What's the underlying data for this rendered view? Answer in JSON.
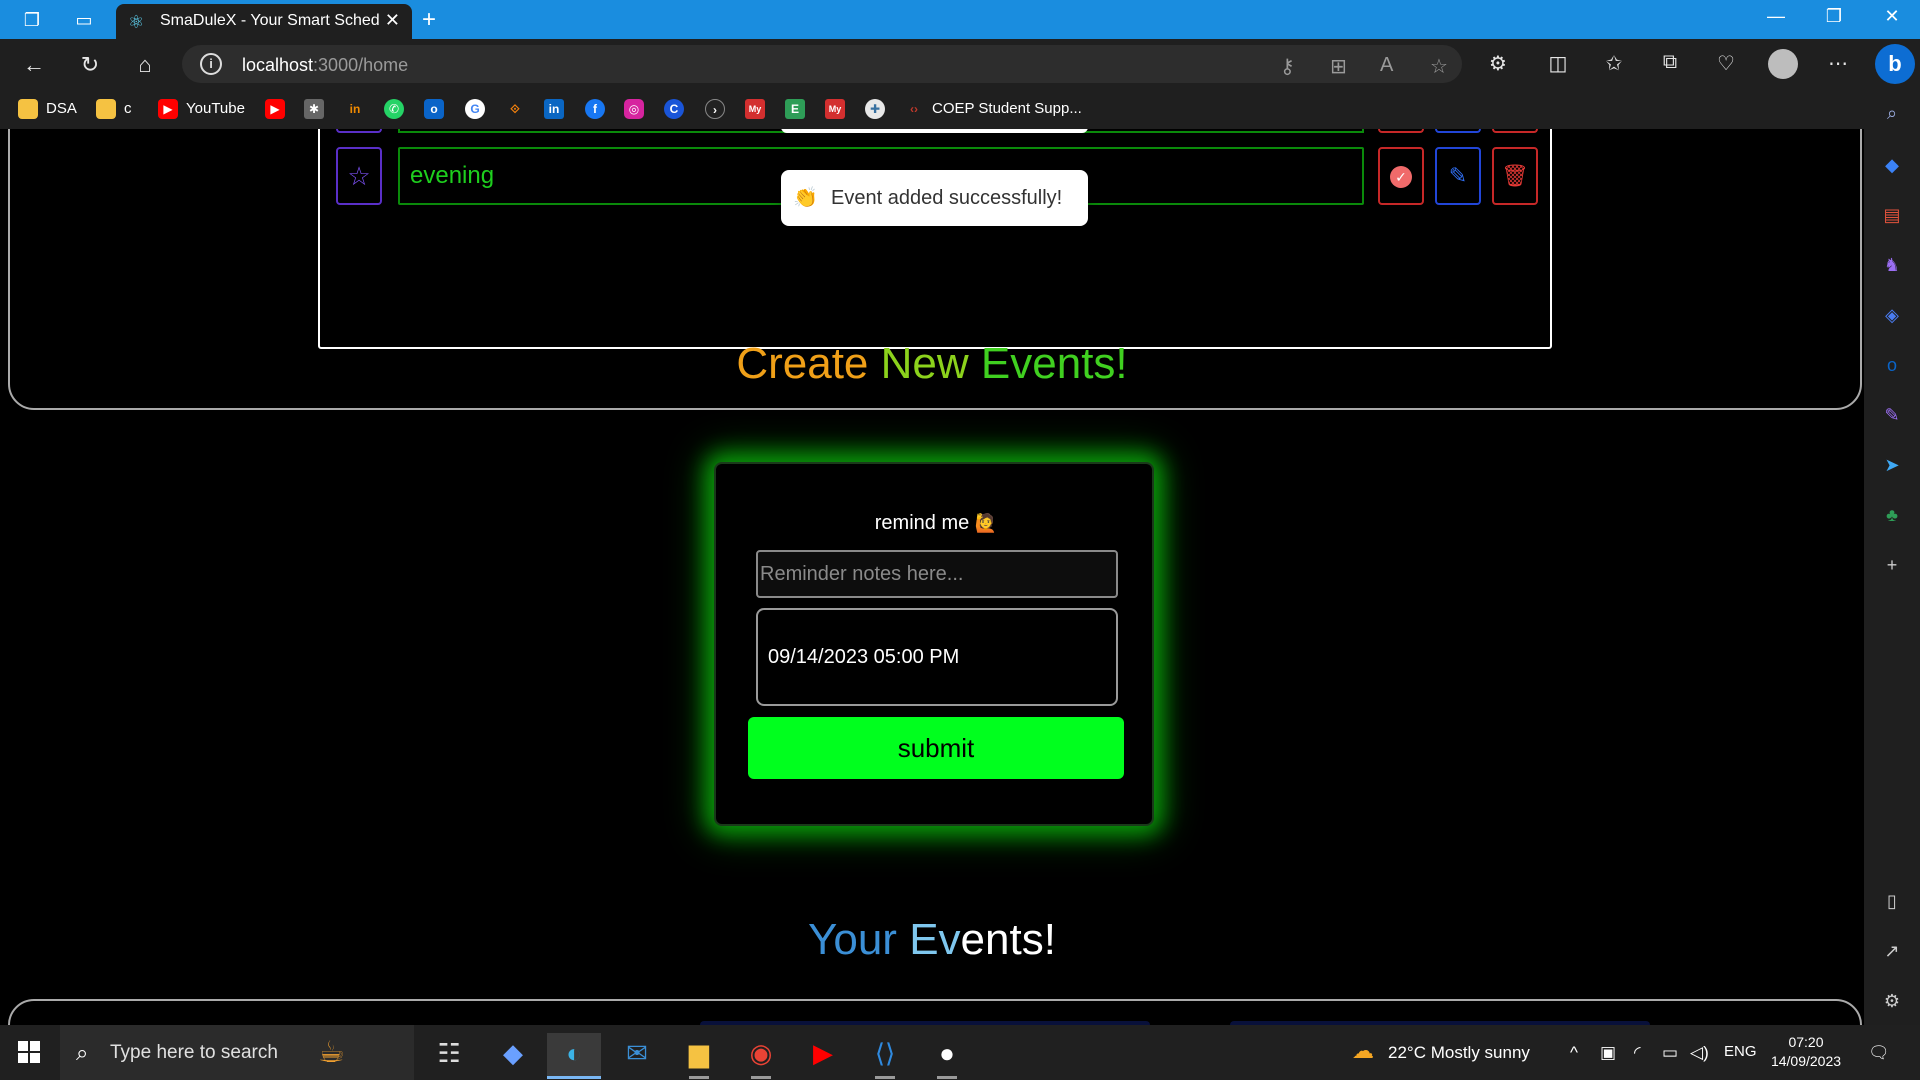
{
  "browser": {
    "tab_title": "SmaDuleX - Your Smart Schedulin",
    "url_host": "localhost",
    "url_path": ":3000/home"
  },
  "bookmarks": [
    {
      "label": "DSA",
      "icon": "folder-icon",
      "color": "#f5c242"
    },
    {
      "label": "c",
      "icon": "folder-icon",
      "color": "#f5c242"
    },
    {
      "label": "YouTube",
      "icon": "youtube-icon",
      "color": "#ff0000"
    },
    {
      "label": "COEP Student Supp...",
      "icon": "coep-icon",
      "color": "#c0392b"
    }
  ],
  "page": {
    "top_event": {
      "text": "evening"
    },
    "toast": {
      "icon": "👏",
      "message": "Event added successfully!"
    },
    "create_heading": {
      "word1": "Create",
      "word2": "New",
      "word3": "Events!"
    },
    "form": {
      "label": "remind me",
      "label_emoji": "🙋",
      "notes_placeholder": "Reminder notes here...",
      "date_value": "09/14/2023 05:00 PM",
      "submit_label": "submit"
    },
    "your_heading": {
      "word1": "Your",
      "word2": "Ev",
      "word3": "ents!"
    }
  },
  "taskbar": {
    "search_placeholder": "Type here to search",
    "weather": "22°C  Mostly sunny",
    "language": "ENG",
    "time": "07:20",
    "date": "14/09/2023"
  },
  "colors": {
    "accent_green": "#00ff1e",
    "event_text_green": "#1ecf1e",
    "titlebar_blue": "#1a8ddf"
  }
}
